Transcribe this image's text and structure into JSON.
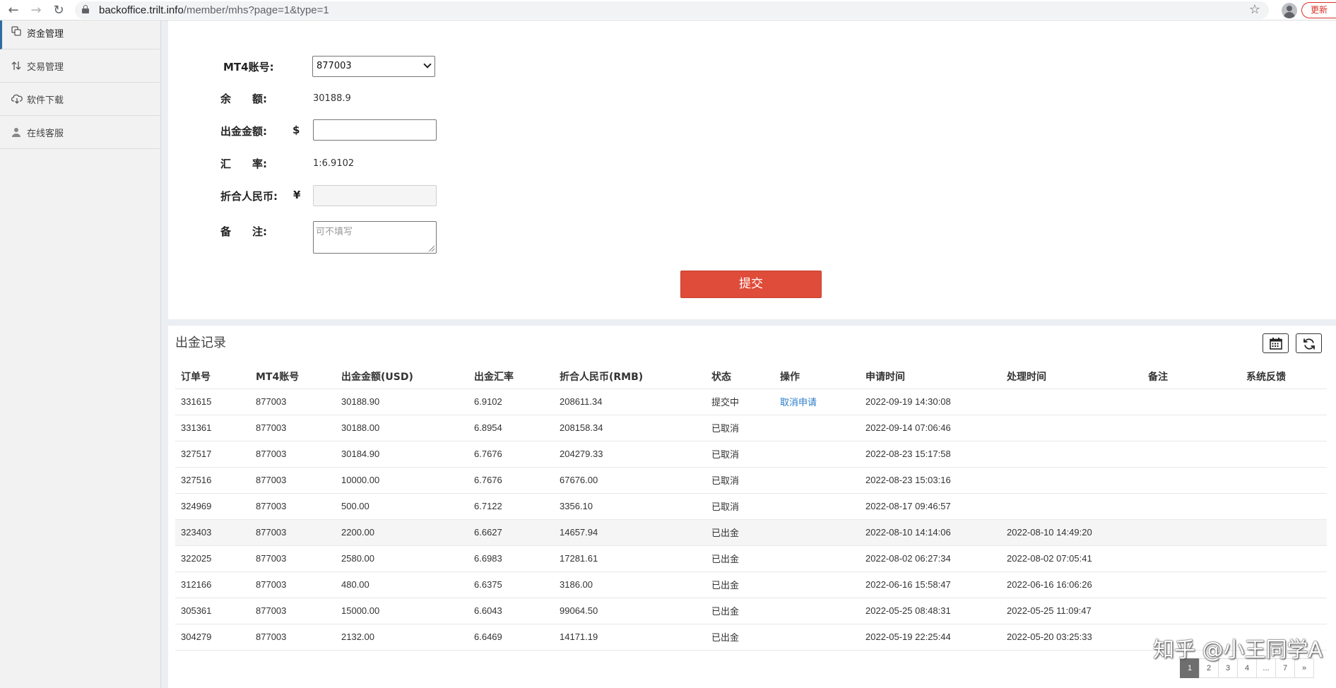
{
  "browser": {
    "url_domain": "backoffice.trilt.info",
    "url_path": "/member/mhs?page=1&type=1",
    "update_label": "更新"
  },
  "sidebar": {
    "items": [
      {
        "label": "资金管理",
        "icon": "coins-icon",
        "active": true
      },
      {
        "label": "交易管理",
        "icon": "exchange-icon",
        "active": false
      },
      {
        "label": "软件下载",
        "icon": "cloud-download-icon",
        "active": false
      },
      {
        "label": "在线客服",
        "icon": "user-icon",
        "active": false
      }
    ]
  },
  "form": {
    "account_label": "MT4账号:",
    "account_value": "877003",
    "balance_label": "余　　额:",
    "balance_value": "30188.9",
    "amount_label": "出金金额:",
    "amount_currency": "$",
    "amount_value": "",
    "rate_label": "汇　　率:",
    "rate_value": "1:6.9102",
    "rmb_label": "折合人民币:",
    "rmb_currency": "¥",
    "rmb_value": "",
    "note_label": "备　　注:",
    "note_placeholder": "可不填写",
    "submit_label": "提交"
  },
  "records": {
    "title": "出金记录",
    "columns": [
      "订单号",
      "MT4账号",
      "出金金额(USD)",
      "出金汇率",
      "折合人民币(RMB)",
      "状态",
      "操作",
      "申请时间",
      "处理时间",
      "备注",
      "系统反馈"
    ],
    "rows": [
      [
        "331615",
        "877003",
        "30188.90",
        "6.9102",
        "208611.34",
        "提交中",
        "取消申请",
        "2022-09-19 14:30:08",
        "",
        "",
        ""
      ],
      [
        "331361",
        "877003",
        "30188.00",
        "6.8954",
        "208158.34",
        "已取消",
        "",
        "2022-09-14 07:06:46",
        "",
        "",
        ""
      ],
      [
        "327517",
        "877003",
        "30184.90",
        "6.7676",
        "204279.33",
        "已取消",
        "",
        "2022-08-23 15:17:58",
        "",
        "",
        ""
      ],
      [
        "327516",
        "877003",
        "10000.00",
        "6.7676",
        "67676.00",
        "已取消",
        "",
        "2022-08-23 15:03:16",
        "",
        "",
        ""
      ],
      [
        "324969",
        "877003",
        "500.00",
        "6.7122",
        "3356.10",
        "已取消",
        "",
        "2022-08-17 09:46:57",
        "",
        "",
        ""
      ],
      [
        "323403",
        "877003",
        "2200.00",
        "6.6627",
        "14657.94",
        "已出金",
        "",
        "2022-08-10 14:14:06",
        "2022-08-10 14:49:20",
        "",
        ""
      ],
      [
        "322025",
        "877003",
        "2580.00",
        "6.6983",
        "17281.61",
        "已出金",
        "",
        "2022-08-02 06:27:34",
        "2022-08-02 07:05:41",
        "",
        ""
      ],
      [
        "312166",
        "877003",
        "480.00",
        "6.6375",
        "3186.00",
        "已出金",
        "",
        "2022-06-16 15:58:47",
        "2022-06-16 16:06:26",
        "",
        ""
      ],
      [
        "305361",
        "877003",
        "15000.00",
        "6.6043",
        "99064.50",
        "已出金",
        "",
        "2022-05-25 08:48:31",
        "2022-05-25 11:09:47",
        "",
        ""
      ],
      [
        "304279",
        "877003",
        "2132.00",
        "6.6469",
        "14171.19",
        "已出金",
        "",
        "2022-05-19 22:25:44",
        "2022-05-20 03:25:33",
        "",
        ""
      ]
    ],
    "highlight_row": 5
  },
  "pagination": {
    "pages": [
      "1",
      "2",
      "3",
      "4",
      "...",
      "7",
      "»"
    ],
    "active": "1"
  },
  "watermark": "知乎 @小王同学A",
  "colors": {
    "submit": "#e04c3a",
    "link": "#2a7cc9",
    "active_border": "#2d6ca2",
    "update": "#d93025"
  }
}
